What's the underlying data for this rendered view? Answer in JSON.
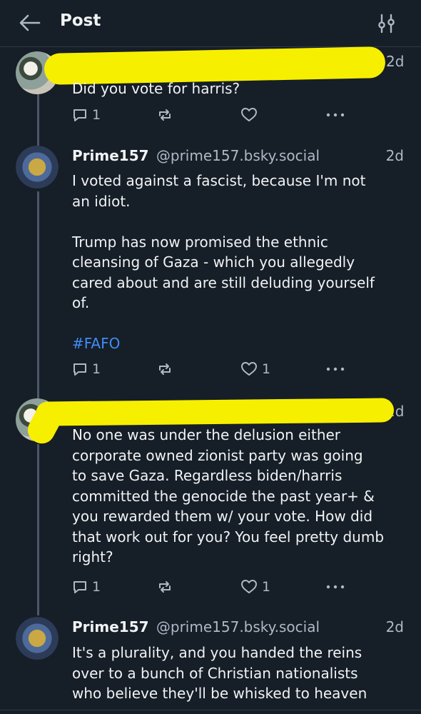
{
  "header": {
    "title": "Post",
    "back_icon": "arrow-left-icon",
    "filter_icon": "sliders-icon"
  },
  "colors": {
    "background": "#161e27",
    "text": "#f1f3f5",
    "muted": "#aeb9c6",
    "hashtag": "#3e8ef7",
    "redaction": "#f7ef00",
    "thread_line": "#4c5868"
  },
  "posts": [
    {
      "author": "",
      "handle": "",
      "redacted": true,
      "time": "2d",
      "lines": [
        "Did you vote for harris?"
      ],
      "reply_count": "1",
      "repost_count": "",
      "like_count": ""
    },
    {
      "author": "Prime157",
      "handle": "@prime157.bsky.social",
      "time": "2d",
      "lines": [
        "I voted against a fascist, because I'm not",
        "an idiot.",
        "",
        "Trump has now promised the ethnic",
        "cleansing of Gaza - which you allegedly",
        "cared about and are still deluding yourself",
        "of.",
        ""
      ],
      "hashtag": "#FAFO",
      "reply_count": "1",
      "repost_count": "",
      "like_count": "1"
    },
    {
      "author": "",
      "handle": "",
      "redacted": true,
      "time": "2d",
      "lines": [
        "No one was under the delusion either",
        "corporate owned zionist party was going",
        "to save Gaza. Regardless biden/harris",
        "committed the genocide the past year+ &",
        "you rewarded them w/ your vote. How did",
        "that work out for you? You feel pretty dumb",
        "right?"
      ],
      "reply_count": "1",
      "repost_count": "",
      "like_count": "1"
    },
    {
      "author": "Prime157",
      "handle": "@prime157.bsky.social",
      "time": "2d",
      "lines": [
        "It's a plurality, and you handed the reins",
        "over to a bunch of Christian nationalists",
        "who believe they'll be whisked to heaven"
      ]
    }
  ],
  "icons": {
    "reply": "reply-bubble-icon",
    "repost": "repost-icon",
    "like": "heart-icon",
    "more": "more-dots-icon"
  }
}
